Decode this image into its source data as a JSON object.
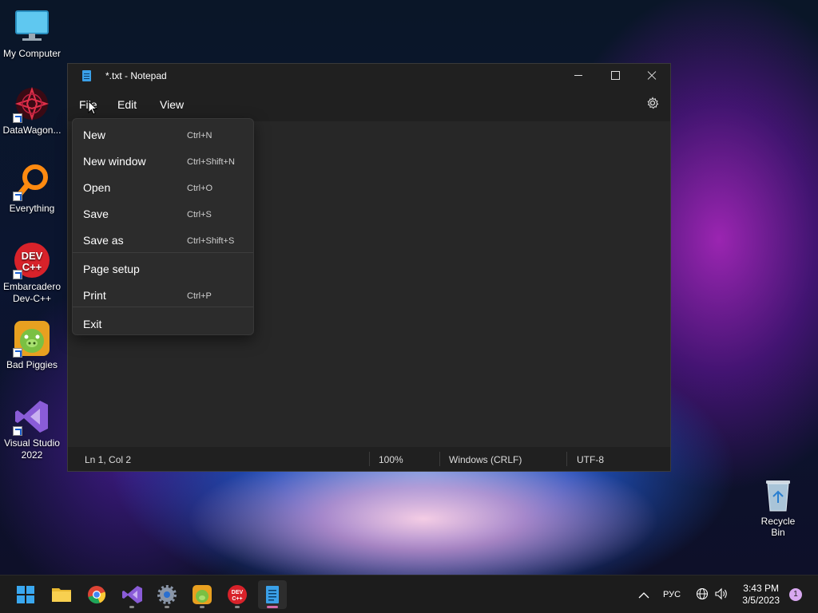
{
  "desktop": {
    "icons": [
      {
        "label": "My Computer",
        "icon": "monitor-icon"
      },
      {
        "label": "DataWagon...",
        "icon": "datawagon-icon"
      },
      {
        "label": "Everything",
        "icon": "search-magnifier-icon"
      },
      {
        "label": "Embarcadero Dev-C++",
        "icon": "devcpp-icon"
      },
      {
        "label": "Bad Piggies",
        "icon": "bad-piggies-icon"
      },
      {
        "label": "Visual Studio 2022",
        "icon": "visual-studio-icon"
      }
    ],
    "recycle_bin": {
      "label": "Recycle Bin"
    }
  },
  "notepad": {
    "title": "*.txt - Notepad",
    "menu": {
      "file": "File",
      "edit": "Edit",
      "view": "View"
    },
    "status": {
      "position": "Ln 1, Col 2",
      "zoom": "100%",
      "line_ending": "Windows (CRLF)",
      "encoding": "UTF-8"
    }
  },
  "file_menu": {
    "items": [
      {
        "label": "New",
        "shortcut": "Ctrl+N"
      },
      {
        "label": "New window",
        "shortcut": "Ctrl+Shift+N"
      },
      {
        "label": "Open",
        "shortcut": "Ctrl+O"
      },
      {
        "label": "Save",
        "shortcut": "Ctrl+S"
      },
      {
        "label": "Save as",
        "shortcut": "Ctrl+Shift+S"
      },
      {
        "label": "Page setup",
        "shortcut": ""
      },
      {
        "label": "Print",
        "shortcut": "Ctrl+P"
      },
      {
        "label": "Exit",
        "shortcut": ""
      }
    ]
  },
  "taskbar": {
    "apps": [
      "start-icon",
      "file-explorer-icon",
      "chrome-icon",
      "visual-studio-icon",
      "settings-icon",
      "bad-piggies-icon",
      "devcpp-icon",
      "notepad-icon"
    ],
    "language": "РУС",
    "time": "3:43 PM",
    "date": "3/5/2023",
    "notification_count": "1"
  },
  "colors": {
    "accent": "#d66aa8",
    "window_bg": "#202020",
    "editor_bg": "#272727",
    "menu_bg": "#2c2c2c"
  }
}
